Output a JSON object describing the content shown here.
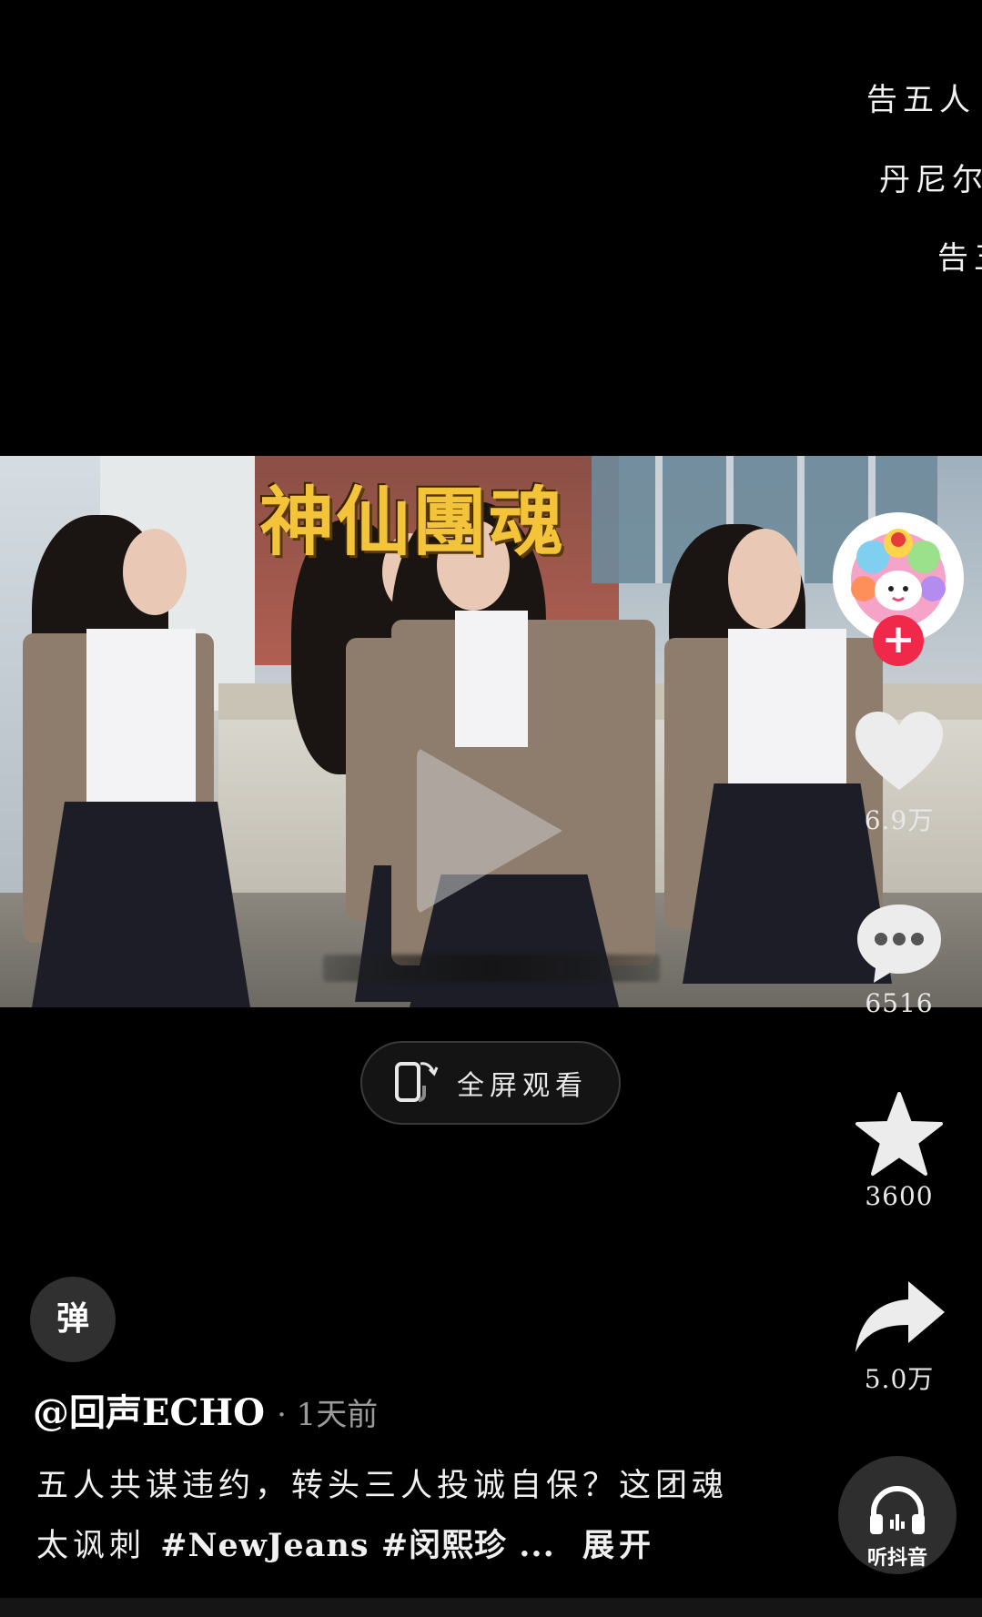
{
  "top_captions": [
    "告五人",
    "丹尼尔",
    "告五"
  ],
  "video": {
    "title_overlay": "神仙團魂"
  },
  "fullscreen": {
    "label": "全屏观看"
  },
  "actions": {
    "like_count": "6.9万",
    "comment_count": "6516",
    "favorite_count": "3600",
    "share_count": "5.0万",
    "listen_label": "听抖音"
  },
  "danmaku": {
    "label": "弹"
  },
  "post": {
    "author": "@回声ECHO",
    "time": "· 1天前",
    "desc_text": "五人共谋违约，转头三人投诚自保？这团魂太讽刺",
    "tags": "#NewJeans #闵熙珍 ...",
    "expand_label": "展开"
  },
  "colors": {
    "background": "#000000",
    "follow_accent": "#f0284a",
    "title_yellow": "#f3c43a"
  },
  "icons": [
    "heart-icon",
    "comment-icon",
    "star-icon",
    "share-icon",
    "headphones-icon",
    "rotate-phone-icon"
  ]
}
